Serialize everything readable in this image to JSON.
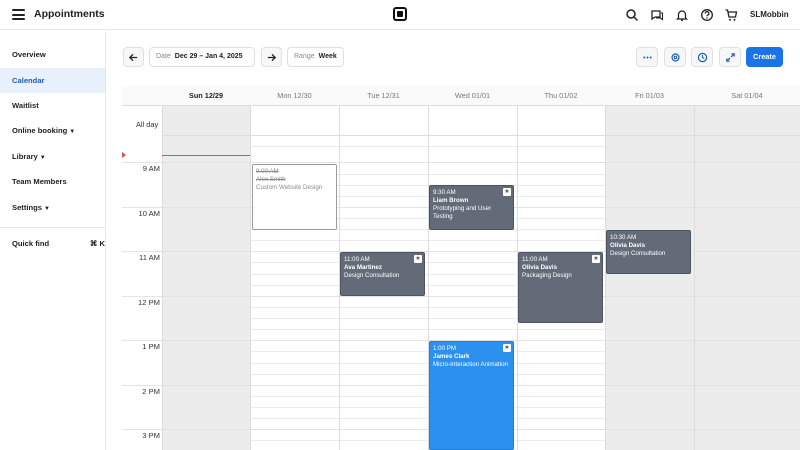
{
  "app": {
    "title": "Appointments",
    "user": "SLMobbin"
  },
  "sidebar": {
    "items": [
      {
        "label": "Overview"
      },
      {
        "label": "Calendar"
      },
      {
        "label": "Waitlist"
      },
      {
        "label": "Online booking"
      },
      {
        "label": "Library"
      },
      {
        "label": "Team Members"
      },
      {
        "label": "Settings"
      }
    ],
    "quick_find": {
      "label": "Quick find",
      "shortcut": "⌘ K"
    }
  },
  "toolbar": {
    "date_label": "Date",
    "date_value": "Dec 29 – Jan 4, 2025",
    "range_label": "Range",
    "range_value": "Week",
    "create_label": "Create"
  },
  "calendar": {
    "days": [
      "Sun 12/29",
      "Mon 12/30",
      "Tue 12/31",
      "Wed 01/01",
      "Thu 01/02",
      "Fri 01/03",
      "Sat 01/04"
    ],
    "all_day_label": "All day",
    "hours": [
      "9 AM",
      "10 AM",
      "11 AM",
      "12 PM",
      "1 PM",
      "2 PM",
      "3 PM"
    ],
    "events": [
      {
        "time": "9:00 AM",
        "name": "Alex Smith",
        "desc": "Custom Website Design",
        "status": "cancelled"
      },
      {
        "time": "9:30 AM",
        "name": "Liam Brown",
        "desc": "Prototyping and User Testing"
      },
      {
        "time": "11:00 AM",
        "name": "Ava Martinez",
        "desc": "Design Consultation"
      },
      {
        "time": "11:00 AM",
        "name": "Olivia Davis",
        "desc": "Packaging Design"
      },
      {
        "time": "10:30 AM",
        "name": "Olivia Davis",
        "desc": "Design Consultation"
      },
      {
        "time": "1:00 PM",
        "name": "James Clark",
        "desc": "Micro-Interaction Animation"
      }
    ]
  },
  "colors": {
    "accent": "#1a73e8",
    "event_gray": "#636b78",
    "event_blue": "#2b90ee",
    "sidebar_active": "#e8f0fb",
    "now_line": "#d9534f"
  },
  "icons": [
    "hamburger-icon",
    "square-logo-icon",
    "search-icon",
    "messages-icon",
    "bell-icon",
    "help-icon",
    "cart-icon",
    "arrow-left-icon",
    "arrow-right-icon",
    "more-icon",
    "settings-icon",
    "clock-icon",
    "expand-icon",
    "star-icon"
  ]
}
